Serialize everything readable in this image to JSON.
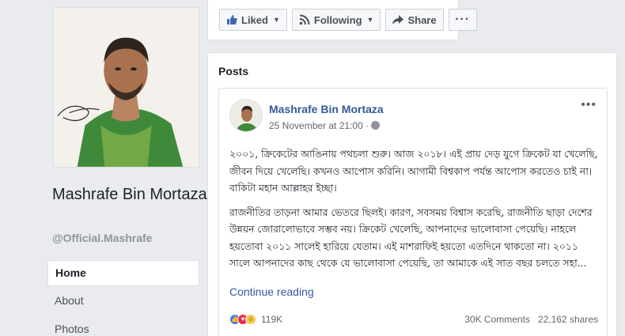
{
  "profile": {
    "name": "Mashrafe Bin Mortaza",
    "username": "@Official.Mashrafe"
  },
  "nav": [
    {
      "label": "Home",
      "active": true
    },
    {
      "label": "About",
      "active": false
    },
    {
      "label": "Photos",
      "active": false
    }
  ],
  "actions": {
    "liked": "Liked",
    "following": "Following",
    "share": "Share",
    "more": "···"
  },
  "posts": {
    "title": "Posts",
    "post": {
      "author": "Mashrafe Bin Mortaza",
      "date": "25 November at 21:00 ·",
      "paragraph1": "২০০১, ক্রিকেটের আঙিনায় পথচলা শুরু। আজ ২০১৮। এই প্রায় দেড় যুগে ক্রিকেট যা খেলেছি, জীবন দিয়ে খেলেছি। কখনও আপোস করিনি। আগামী বিশ্বকাপ পর্যন্ত আপোস করতেও চাই না। বাকিটা মহান আল্লাহর ইচ্ছা।",
      "paragraph2": "রাজনীতির তাড়না আমার ভেতরে ছিলই। কারণ, সবসময় বিশ্বাস করেছি, রাজনীতি ছাড়া দেশের উন্নয়ন জোরালোভাবে সম্ভব নয়। ক্রিকেট খেলেছি, আপনাদের ভালোবাসা পেয়েছি। নাহলে হয়তোবা ২০১১ সালেই হারিয়ে যেতাম। এই মাশরাফিই হয়তো এতদিনে থাকতো না। ২০১১ সালে আপনাদের কাছ থেকে যে ভালোবাসা পেয়েছি, তা আমাকে এই সাত বছর চলতে সহা...",
      "continue": "Continue reading",
      "reactions": "119K",
      "comments": "30K Comments",
      "shares": "22,162 shares",
      "menu": "•••"
    }
  }
}
